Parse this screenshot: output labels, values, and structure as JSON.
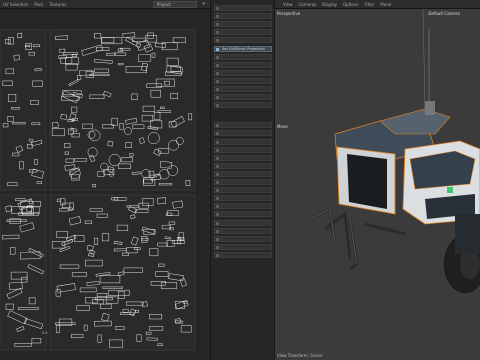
{
  "uv_editor": {
    "menu": [
      "UV Selection",
      "Pack",
      "Textures"
    ],
    "project_select": "Project",
    "scroll_value": "0.0"
  },
  "tool_panel": {
    "highlight_label": "Set UV/Mirror Projection",
    "rows": 30
  },
  "viewport": {
    "menu": [
      "View",
      "Cameras",
      "Display",
      "Options",
      "Filter",
      "Panel"
    ],
    "view_label": "Perspective",
    "camera_label": "Default Camera",
    "status_text": "View Transform: Scene",
    "axis_label": "Move"
  },
  "colors": {
    "panel_bg": "#232323",
    "viewport_bg": "#3b3b3b",
    "highlight": "#3d4850",
    "selection_orange": "#e0821e",
    "accent_green": "#38c872"
  }
}
